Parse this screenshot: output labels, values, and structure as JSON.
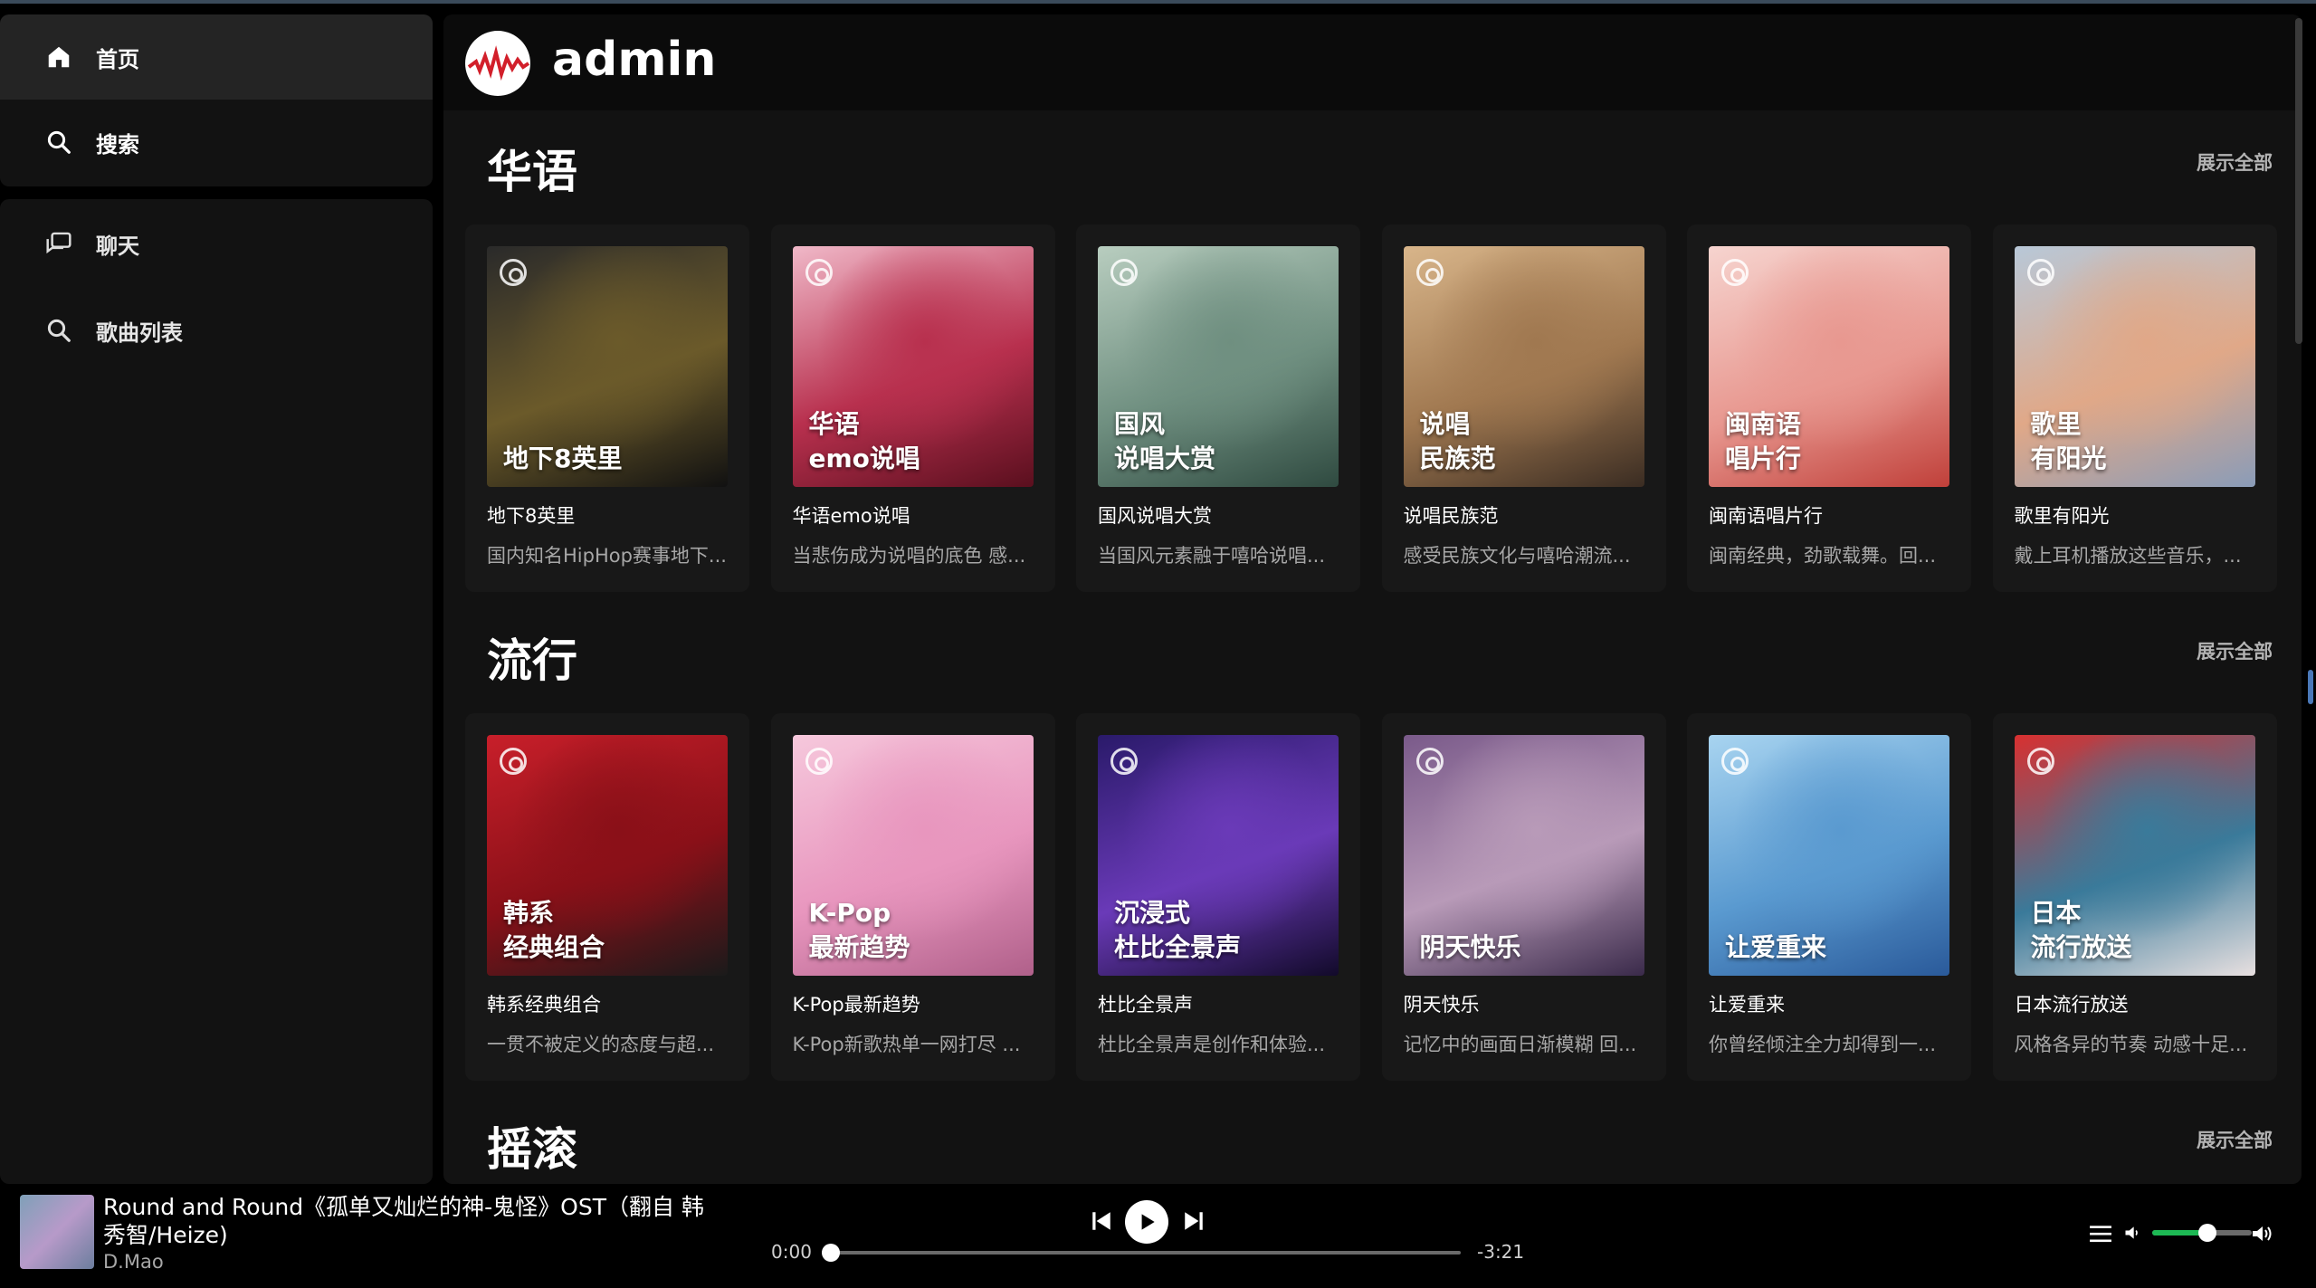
{
  "app": {
    "user": "admin"
  },
  "sidebar": {
    "top": [
      {
        "label": "首页",
        "icon": "home-icon",
        "active": true
      },
      {
        "label": "搜索",
        "icon": "search-icon",
        "active": false
      }
    ],
    "bottom": [
      {
        "label": "聊天",
        "icon": "chat-icon"
      },
      {
        "label": "歌曲列表",
        "icon": "search-icon"
      }
    ]
  },
  "sections": [
    {
      "title": "华语",
      "show_all": "展示全部",
      "cards": [
        {
          "title": "地下8英里",
          "desc": "国内知名HipHop赛事地下...",
          "overlay": "地下8英里",
          "colors": [
            "#2a2a2a",
            "#6b5a2a",
            "#111111"
          ]
        },
        {
          "title": "华语emo说唱",
          "desc": "当悲伤成为说唱的底色 感...",
          "overlay": "华语\nemo说唱",
          "colors": [
            "#f0b8c8",
            "#b8304e",
            "#5a0f1e"
          ]
        },
        {
          "title": "国风说唱大赏",
          "desc": "当国风元素融于嘻哈说唱...",
          "overlay": "国风\n说唱大赏",
          "colors": [
            "#b8cdbf",
            "#6f8f80",
            "#2f4a40"
          ]
        },
        {
          "title": "说唱民族范",
          "desc": "感受民族文化与嘻哈潮流...",
          "overlay": "说唱\n民族范",
          "colors": [
            "#d8b58a",
            "#a07850",
            "#3a2c22"
          ]
        },
        {
          "title": "闽南语唱片行",
          "desc": "闽南经典，劲歌载舞。回...",
          "overlay": "闽南语\n唱片行",
          "colors": [
            "#f6d4cf",
            "#e89890",
            "#c0403a"
          ]
        },
        {
          "title": "歌里有阳光",
          "desc": "戴上耳机播放这些音乐，...",
          "overlay": "歌里\n有阳光",
          "colors": [
            "#b8c8d8",
            "#e0a888",
            "#8a9cb8"
          ]
        }
      ]
    },
    {
      "title": "流行",
      "show_all": "展示全部",
      "cards": [
        {
          "title": "韩系经典组合",
          "desc": "一贯不被定义的态度与超...",
          "overlay": "韩系\n经典组合",
          "colors": [
            "#c81f2a",
            "#8a1018",
            "#1a1a1a"
          ]
        },
        {
          "title": "K-Pop最新趋势",
          "desc": "K-Pop新歌热单一网打尽 ...",
          "overlay": "K-Pop\n最新趋势",
          "colors": [
            "#f6c8dc",
            "#e896be",
            "#b0608a"
          ]
        },
        {
          "title": "杜比全景声",
          "desc": "杜比全景声是创作和体验...",
          "overlay": "沉浸式\n杜比全景声",
          "colors": [
            "#2a1a6a",
            "#6a3ab8",
            "#120a2a"
          ]
        },
        {
          "title": "阴天快乐",
          "desc": "记忆中的画面日渐模糊 回...",
          "overlay": "阴天快乐",
          "colors": [
            "#7a5a8a",
            "#b89ab8",
            "#3a2a4a"
          ]
        },
        {
          "title": "让爱重来",
          "desc": "你曾经倾注全力却得到一...",
          "overlay": "让爱重来",
          "colors": [
            "#a8d4f0",
            "#5a9ad0",
            "#2a5a9a"
          ]
        },
        {
          "title": "日本流行放送",
          "desc": "风格各异的节奏 动感十足...",
          "overlay": "日本\n流行放送",
          "colors": [
            "#d83030",
            "#3a7a9a",
            "#e8e0e0"
          ]
        }
      ]
    },
    {
      "title": "摇滚",
      "show_all": "展示全部",
      "cards": []
    }
  ],
  "player": {
    "title": "Round and Round《孤单又灿烂的神-鬼怪》OST（翻自 韩秀智/Heize)",
    "artist": "D.Mao",
    "time_current": "0:00",
    "time_remaining": "-3:21",
    "progress": 0.0,
    "volume": 0.55,
    "accent": "#1db954"
  }
}
